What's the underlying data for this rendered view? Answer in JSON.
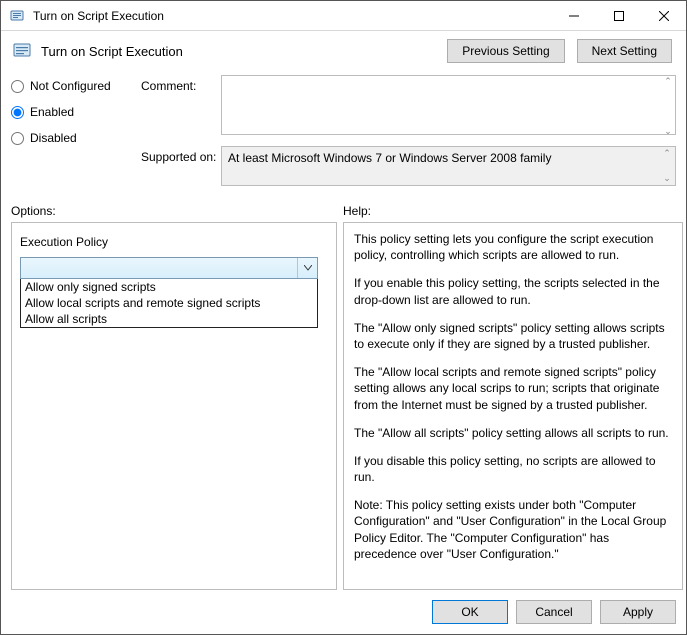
{
  "window": {
    "title": "Turn on Script Execution",
    "subtitle": "Turn on Script Execution",
    "nav": {
      "prev": "Previous Setting",
      "next": "Next Setting"
    }
  },
  "state": {
    "options": [
      "Not Configured",
      "Enabled",
      "Disabled"
    ],
    "selected": "Enabled"
  },
  "fields": {
    "commentLabel": "Comment:",
    "commentValue": "",
    "supportedLabel": "Supported on:",
    "supportedValue": "At least Microsoft Windows 7 or Windows Server 2008 family"
  },
  "sections": {
    "optionsLabel": "Options:",
    "helpLabel": "Help:"
  },
  "options": {
    "execPolicyLabel": "Execution Policy",
    "dropdownSelected": "",
    "dropdownItems": [
      "Allow only signed scripts",
      "Allow local scripts and remote signed scripts",
      "Allow all scripts"
    ]
  },
  "help": {
    "p1": "This policy setting lets you configure the script execution policy, controlling which scripts are allowed to run.",
    "p2": "If you enable this policy setting, the scripts selected in the drop-down list are allowed to run.",
    "p3": "The \"Allow only signed scripts\" policy setting allows scripts to execute only if they are signed by a trusted publisher.",
    "p4": "The \"Allow local scripts and remote signed scripts\" policy setting allows any local scrips to run; scripts that originate from the Internet must be signed by a trusted publisher.",
    "p5": "The \"Allow all scripts\" policy setting allows all scripts to run.",
    "p6": "If you disable this policy setting, no scripts are allowed to run.",
    "p7": "Note: This policy setting exists under both \"Computer Configuration\" and \"User Configuration\" in the Local Group Policy Editor. The \"Computer Configuration\" has precedence over \"User Configuration.\""
  },
  "footer": {
    "ok": "OK",
    "cancel": "Cancel",
    "apply": "Apply"
  }
}
